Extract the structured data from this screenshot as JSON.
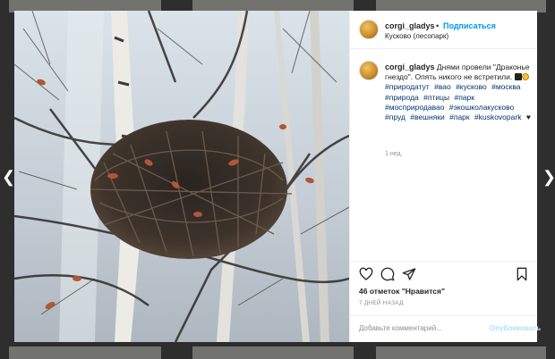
{
  "post": {
    "username": "corgi_gladys",
    "follow_label": "Подписаться",
    "location": "Кусково (лесопарк)",
    "caption_text": "Днями провели \"Драконье гнездо\". Опять никого не встретили.",
    "hashtags": [
      "#природатут",
      "#вао",
      "#кусково",
      "#москва",
      "#природа",
      "#птицы",
      "#парк",
      "#мосприродавао",
      "#экошколакусково",
      "#пруд",
      "#вешняки",
      "#парк",
      "#kuskovopark"
    ],
    "time_ago": "1 нед.",
    "likes_text": "46 отметок \"Нравится\"",
    "date_text": "7 ДНЕЙ НАЗАД",
    "comment_placeholder": "Добавьте комментарий...",
    "publish_label": "Опубликовать"
  },
  "icons": {
    "like": "heart-outline-icon",
    "comment": "speech-bubble-icon",
    "share": "paper-plane-icon",
    "save": "bookmark-icon",
    "nav_prev": "chevron-left-icon",
    "nav_next": "chevron-right-icon"
  },
  "colors": {
    "link_blue": "#0095f6",
    "hashtag": "#00376b",
    "muted": "#8e8e8e",
    "publish_disabled": "#b2dffc"
  }
}
